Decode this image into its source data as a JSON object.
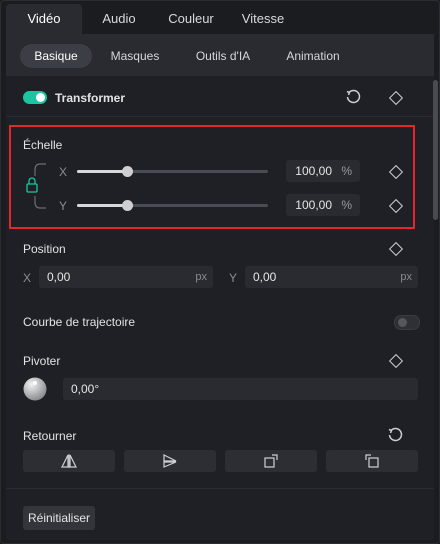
{
  "top_tabs": [
    "Vidéo",
    "Audio",
    "Couleur",
    "Vitesse"
  ],
  "sub_tabs": [
    "Basique",
    "Masques",
    "Outils d'IA",
    "Animation"
  ],
  "transform": {
    "label": "Transformer",
    "enabled": true
  },
  "scale": {
    "title": "Échelle",
    "x_label": "X",
    "y_label": "Y",
    "x_value": "100,00",
    "y_value": "100,00",
    "unit": "%",
    "x_slider_fraction": 0.26,
    "y_slider_fraction": 0.26
  },
  "position": {
    "title": "Position",
    "x_label": "X",
    "x_value": "0,00",
    "y_label": "Y",
    "y_value": "0,00",
    "unit": "px"
  },
  "trajectory": {
    "label": "Courbe de trajectoire",
    "enabled": false
  },
  "rotate": {
    "title": "Pivoter",
    "value": "0,00°"
  },
  "flip": {
    "title": "Retourner"
  },
  "reset_label": "Réinitialiser",
  "colors": {
    "accent": "#19c6a1",
    "highlight": "#e5262d"
  }
}
